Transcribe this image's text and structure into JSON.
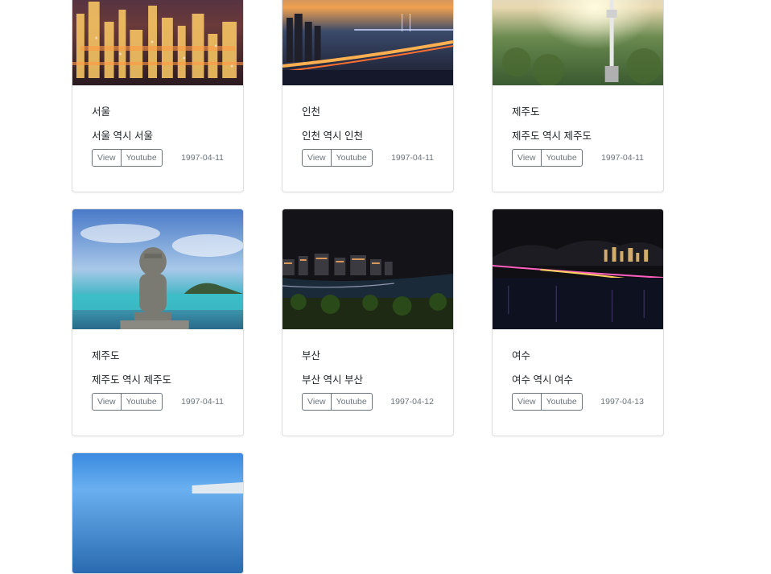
{
  "cards": [
    {
      "title": "서울",
      "text": "서울 역시 서울",
      "view": "View",
      "youtube": "Youtube",
      "date": "1997-04-11",
      "image": "seoul-night-city"
    },
    {
      "title": "인천",
      "text": "인천 역시 인천",
      "view": "View",
      "youtube": "Youtube",
      "date": "1997-04-11",
      "image": "incheon-bridge-sunset"
    },
    {
      "title": "제주도",
      "text": "제주도 역시 제주도",
      "view": "View",
      "youtube": "Youtube",
      "date": "1997-04-11",
      "image": "seoul-tower-sunrise"
    },
    {
      "title": "제주도",
      "text": "제주도 역시 제주도",
      "view": "View",
      "youtube": "Youtube",
      "date": "1997-04-11",
      "image": "dol-hareubang-sea"
    },
    {
      "title": "부산",
      "text": "부산 역시 부산",
      "view": "View",
      "youtube": "Youtube",
      "date": "1997-04-12",
      "image": "busan-beach-night"
    },
    {
      "title": "여수",
      "text": "여수 역시 여수",
      "view": "View",
      "youtube": "Youtube",
      "date": "1997-04-13",
      "image": "yeosu-harbor-night"
    },
    {
      "image": "blue-sky-coast"
    }
  ]
}
